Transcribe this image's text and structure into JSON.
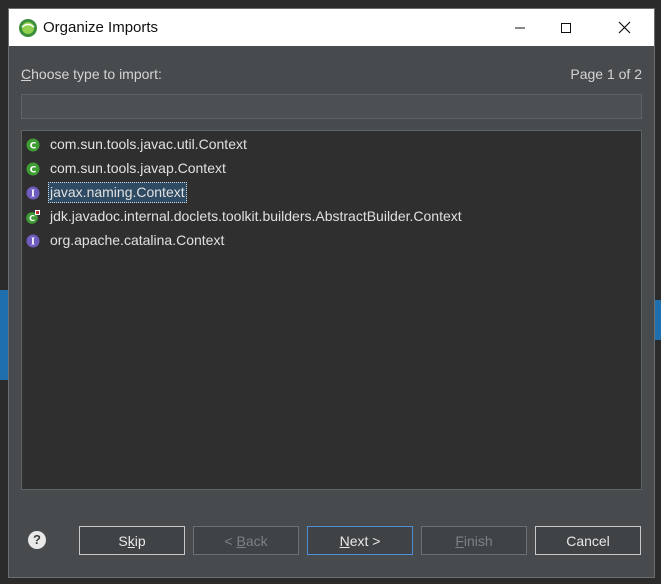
{
  "window": {
    "title": "Organize Imports"
  },
  "titlebar_controls": [
    "minimize-icon",
    "maximize-icon",
    "close-icon"
  ],
  "prompt": {
    "mnemonic": "C",
    "rest": "hoose type to import:"
  },
  "page_indicator": "Page 1 of 2",
  "filter": {
    "value": "",
    "placeholder": ""
  },
  "items": [
    {
      "label": "com.sun.tools.javac.util.Context",
      "icon": "class-icon",
      "selected": false
    },
    {
      "label": "com.sun.tools.javap.Context",
      "icon": "class-icon",
      "selected": false
    },
    {
      "label": "javax.naming.Context",
      "icon": "interface-icon",
      "selected": true
    },
    {
      "label": "jdk.javadoc.internal.doclets.toolkit.builders.AbstractBuilder.Context",
      "icon": "class-icon",
      "selected": false
    },
    {
      "label": "org.apache.catalina.Context",
      "icon": "interface-icon",
      "selected": false
    }
  ],
  "buttons": {
    "skip": {
      "mn": "",
      "mnemonic": "k",
      "rest": "ip",
      "pre": "S"
    },
    "back": {
      "pre": "< ",
      "mnemonic": "B",
      "rest": "ack"
    },
    "next": {
      "pre": "",
      "mnemonic": "N",
      "rest": "ext >"
    },
    "finish": {
      "pre": "",
      "mnemonic": "F",
      "rest": "inish"
    },
    "cancel": {
      "label": "Cancel"
    }
  },
  "help": "?",
  "colors": {
    "class_icon": "#3f9c35",
    "interface_icon": "#6f5bbd",
    "selection": "#2f4a63",
    "default_button_border": "#4b8fd6"
  }
}
